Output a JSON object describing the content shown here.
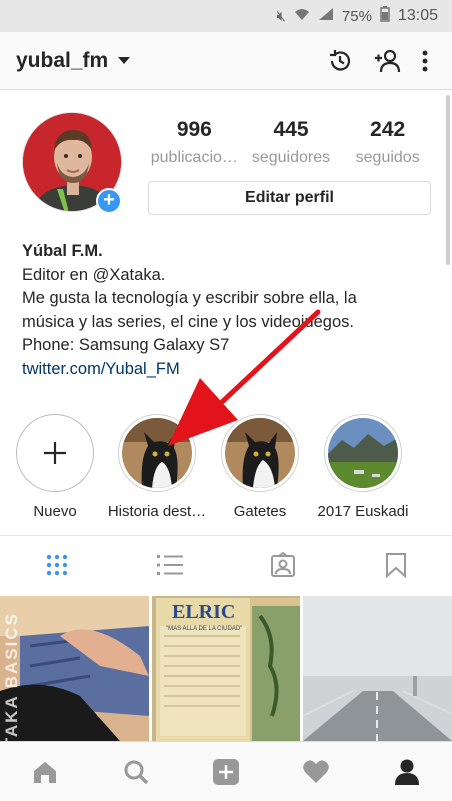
{
  "status_bar": {
    "battery": "75%",
    "time": "13:05",
    "icons": [
      "mute-icon",
      "wifi-icon",
      "signal-icon",
      "battery-icon"
    ]
  },
  "header": {
    "username": "yubal_fm",
    "icons": [
      "history-icon",
      "add-person-icon",
      "more-vertical-icon"
    ]
  },
  "profile": {
    "stats": [
      {
        "value": "996",
        "label": "publicacio…"
      },
      {
        "value": "445",
        "label": "seguidores"
      },
      {
        "value": "242",
        "label": "seguidos"
      }
    ],
    "edit_button": "Editar perfil"
  },
  "bio": {
    "name": "Yúbal F.M.",
    "line1": "Editor en @Xataka.",
    "line2": "Me gusta la tecnología y escribir sobre ella, la",
    "line3": "música y las series, el cine y los videojuegos.",
    "line4": "Phone: Samsung Galaxy S7",
    "link": "twitter.com/Yubal_FM"
  },
  "highlights": [
    {
      "label": "Nuevo"
    },
    {
      "label": "Historia dest…"
    },
    {
      "label": "Gatetes"
    },
    {
      "label": "2017 Euskadi"
    }
  ],
  "tabs": [
    "grid-icon",
    "list-icon",
    "tagged-icon",
    "bookmark-icon"
  ],
  "grid_images": [
    {
      "title": ""
    },
    {
      "title": "ELRIC",
      "subtitle": "\"MAS ALLA DE LA CIUDAD\""
    },
    {
      "title": ""
    }
  ],
  "watermark": "XATAKA BASICS",
  "bottom_nav": [
    "home-icon",
    "search-icon",
    "add-post-icon",
    "heart-icon",
    "profile-icon"
  ],
  "colors": {
    "accent": "#3897f0",
    "link": "#003569",
    "arrow": "#e3131b"
  }
}
